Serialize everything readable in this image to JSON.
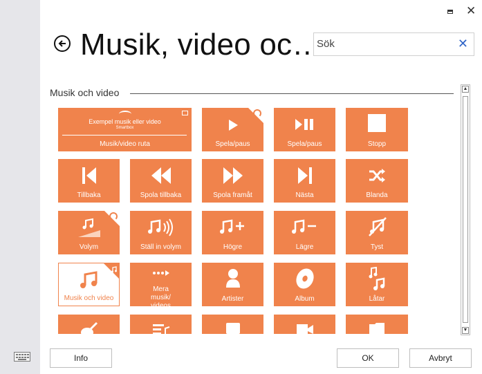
{
  "window": {
    "maximize_icon": "maximize-icon",
    "close_glyph": "✕"
  },
  "header": {
    "title": "Musik, video oc…"
  },
  "search": {
    "placeholder": "Sök",
    "clear_glyph": "✕"
  },
  "section": {
    "label": "Musik och video"
  },
  "tiles": [
    {
      "label": "Musik/video ruta",
      "icon": "media-player-icon",
      "sub1": "Exempel musik eller video",
      "sub2": "Smartbox"
    },
    {
      "label": "Spela/paus",
      "icon": "play-icon"
    },
    {
      "label": "Spela/paus",
      "icon": "play-pause-icon"
    },
    {
      "label": "Stopp",
      "icon": "stop-icon"
    },
    {
      "label": "Tillbaka",
      "icon": "skip-back-icon"
    },
    {
      "label": "Spola tillbaka",
      "icon": "rewind-icon"
    },
    {
      "label": "Spola framåt",
      "icon": "fast-forward-icon"
    },
    {
      "label": "Nästa",
      "icon": "skip-next-icon"
    },
    {
      "label": "Blanda",
      "icon": "shuffle-icon"
    },
    {
      "label": "Volym",
      "icon": "volume-icon"
    },
    {
      "label": "Ställ in volym",
      "icon": "set-volume-icon"
    },
    {
      "label": "Högre",
      "icon": "volume-up-icon"
    },
    {
      "label": "Lägre",
      "icon": "volume-down-icon"
    },
    {
      "label": "Tyst",
      "icon": "mute-icon"
    },
    {
      "label": "Musik och video",
      "icon": "music-note-icon"
    },
    {
      "label": "Mera musik/ videos",
      "icon": "more-icon"
    },
    {
      "label": "Artister",
      "icon": "artist-icon"
    },
    {
      "label": "Album",
      "icon": "album-icon"
    },
    {
      "label": "Låtar",
      "icon": "songs-icon"
    },
    {
      "label": "",
      "icon": "guitar-icon"
    },
    {
      "label": "",
      "icon": "playlist-icon"
    },
    {
      "label": "",
      "icon": "music-video-icon"
    },
    {
      "label": "",
      "icon": "video-icon"
    },
    {
      "label": "",
      "icon": "folder-icon"
    }
  ],
  "footer": {
    "info": "Info",
    "ok": "OK",
    "cancel": "Avbryt"
  },
  "colors": {
    "accent": "#f0834c",
    "link": "#2f64c8"
  }
}
